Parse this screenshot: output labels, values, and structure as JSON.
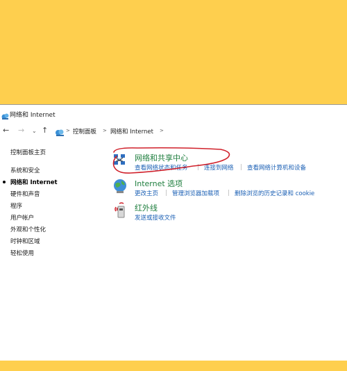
{
  "window": {
    "title": "网络和 Internet"
  },
  "navigation": {
    "back_icon": "←",
    "forward_icon": "→",
    "recent_icon": "⌄",
    "up_icon": "↑",
    "separator": ">",
    "breadcrumbs": [
      "控制面板",
      "网络和 Internet"
    ]
  },
  "sidebar": {
    "items": [
      {
        "label": "控制面板主页"
      },
      {
        "label": "系统和安全"
      },
      {
        "label": "网络和 Internet"
      },
      {
        "label": "硬件和声音"
      },
      {
        "label": "程序"
      },
      {
        "label": "用户帐户"
      },
      {
        "label": "外观和个性化"
      },
      {
        "label": "时钟和区域"
      },
      {
        "label": "轻松使用"
      }
    ]
  },
  "categories": [
    {
      "title": "网络和共享中心",
      "icon": "network-sharing-icon",
      "links": [
        "查看网络状态和任务",
        "连接到网络",
        "查看网络计算机和设备"
      ]
    },
    {
      "title": "Internet 选项",
      "icon": "internet-options-icon",
      "links": [
        "更改主页",
        "管理浏览器加载项",
        "删除浏览的历史记录和 cookie"
      ]
    },
    {
      "title": "红外线",
      "icon": "infrared-icon",
      "links": [
        "发送或接收文件"
      ]
    }
  ],
  "colors": {
    "background": "#FECF4E",
    "category_title": "#1e7e3e",
    "link": "#1a5fb4",
    "annotation": "#d0202a"
  }
}
